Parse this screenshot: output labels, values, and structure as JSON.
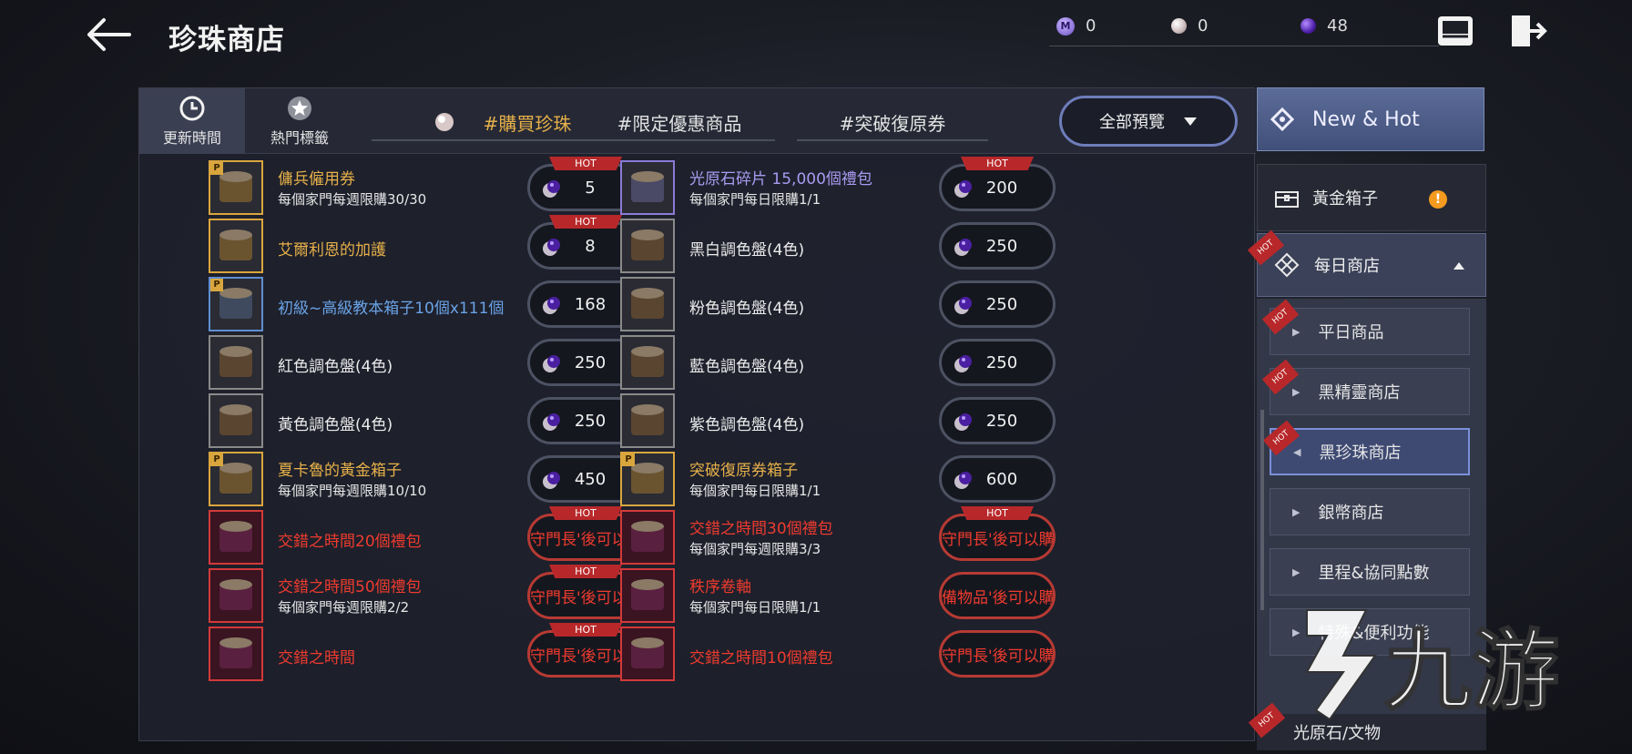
{
  "header": {
    "title": "珍珠商店",
    "currencies": [
      {
        "icon": "m-coin-icon",
        "value": "0"
      },
      {
        "icon": "pearl-icon",
        "value": "0"
      },
      {
        "icon": "dark-pearl-icon",
        "value": "48"
      }
    ]
  },
  "tabs": {
    "refresh_time": "更新時間",
    "hot_tags": "熱門標籤",
    "buy_pearls": "#購買珍珠",
    "limited_offers": "#限定優惠商品",
    "breakthrough_coupon": "#突破復原券",
    "dropdown": "全部預覽"
  },
  "items": [
    {
      "name": "傭兵僱用券",
      "sub": "每個家門每週限購30/30",
      "price": "5",
      "hot": "HOT",
      "color": "gold",
      "p": "P"
    },
    {
      "name": "光原石碎片 15,000個禮包",
      "sub": "每個家門每日限購1/1",
      "price": "200",
      "hot": "HOT",
      "color": "purple"
    },
    {
      "name": "艾爾利恩的加護",
      "price": "8",
      "hot": "HOT",
      "color": "gold"
    },
    {
      "name": "黑白調色盤(4色)",
      "price": "250",
      "color": "white"
    },
    {
      "name": "初級~高級教本箱子10個x111個",
      "price": "168",
      "color": "blue",
      "p": "P"
    },
    {
      "name": "粉色調色盤(4色)",
      "price": "250",
      "color": "white"
    },
    {
      "name": "紅色調色盤(4色)",
      "price": "250",
      "color": "white"
    },
    {
      "name": "藍色調色盤(4色)",
      "price": "250",
      "color": "white"
    },
    {
      "name": "黃色調色盤(4色)",
      "price": "250",
      "color": "white"
    },
    {
      "name": "紫色調色盤(4色)",
      "price": "250",
      "color": "white"
    },
    {
      "name": "夏卡魯的黃金箱子",
      "sub": "每個家門每週限購10/10",
      "price": "450",
      "color": "gold",
      "p": "P"
    },
    {
      "name": "突破復原券箱子",
      "sub": "每個家門每日限購1/1",
      "price": "600",
      "color": "gold",
      "p": "P"
    },
    {
      "name": "交錯之時間20個禮包",
      "price": "守門長'後可以購",
      "hot": "HOT",
      "color": "red"
    },
    {
      "name": "交錯之時間30個禮包",
      "sub": "每個家門每週限購3/3",
      "price": "守門長'後可以購",
      "hot": "HOT",
      "color": "red"
    },
    {
      "name": "交錯之時間50個禮包",
      "sub": "每個家門每週限購2/2",
      "price": "守門長'後可以購",
      "hot": "HOT",
      "color": "red"
    },
    {
      "name": "秩序卷軸",
      "sub": "每個家門每日限購1/1",
      "price": "備物品'後可以購",
      "color": "red"
    },
    {
      "name": "交錯之時間",
      "price": "守門長'後可以購",
      "hot": "HOT",
      "color": "red"
    },
    {
      "name": "交錯之時間10個禮包",
      "price": "守門長'後可以購",
      "color": "red"
    }
  ],
  "sidebar": {
    "new_hot": "New & Hot",
    "gold_box": "黃金箱子",
    "gold_box_alert": "!",
    "daily_shop": "每日商店",
    "hot_badge": "HOT",
    "subs": [
      "平日商品",
      "黑精靈商店",
      "黑珍珠商店",
      "銀幣商店",
      "里程&協同點數",
      "特殊&便利功能"
    ],
    "bottom": "光原石/文物"
  },
  "watermark": "九游"
}
